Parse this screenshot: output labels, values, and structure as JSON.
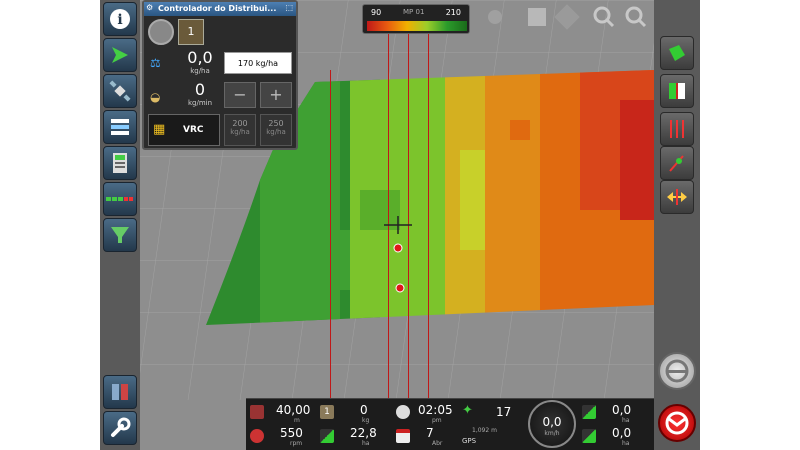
{
  "panel": {
    "title": "Controlador do Distribui...",
    "section_badge": "1",
    "rate_value": "0,0",
    "rate_unit": "kg/ha",
    "target_rate": "170 kg/ha",
    "flow_value": "0",
    "flow_unit": "kg/min",
    "minus": "−",
    "plus": "+",
    "vrc_label": "VRC",
    "preset1_value": "200",
    "preset1_unit": "kg/ha",
    "preset2_value": "250",
    "preset2_unit": "kg/ha"
  },
  "gauge": {
    "min": "90",
    "mid": "MP 01",
    "max": "210"
  },
  "bottom": {
    "speed_value": "40,00",
    "speed_unit": "m",
    "rpm_value": "550",
    "rpm_unit": "rpm",
    "bin_badge": "1",
    "bin_value": "0",
    "bin_unit": "kg",
    "area_value": "22,8",
    "area_unit": "ha",
    "time_value": "02:05",
    "time_unit": "pm",
    "date_value": "7",
    "date_unit": "Abr",
    "sat_value": "17",
    "sat_sub": "1,092 m",
    "gps_label": "GPS",
    "dial_value": "0,0",
    "dial_unit": "km/h",
    "area1_value": "0,0",
    "area1_unit": "ha",
    "area2_value": "0,0",
    "area2_unit": "ha"
  },
  "colors": {
    "dark_green": "#2e8b2e",
    "light_green": "#7cc42c",
    "yellow": "#d4b020",
    "orange": "#e06a10",
    "red": "#c8261a"
  }
}
